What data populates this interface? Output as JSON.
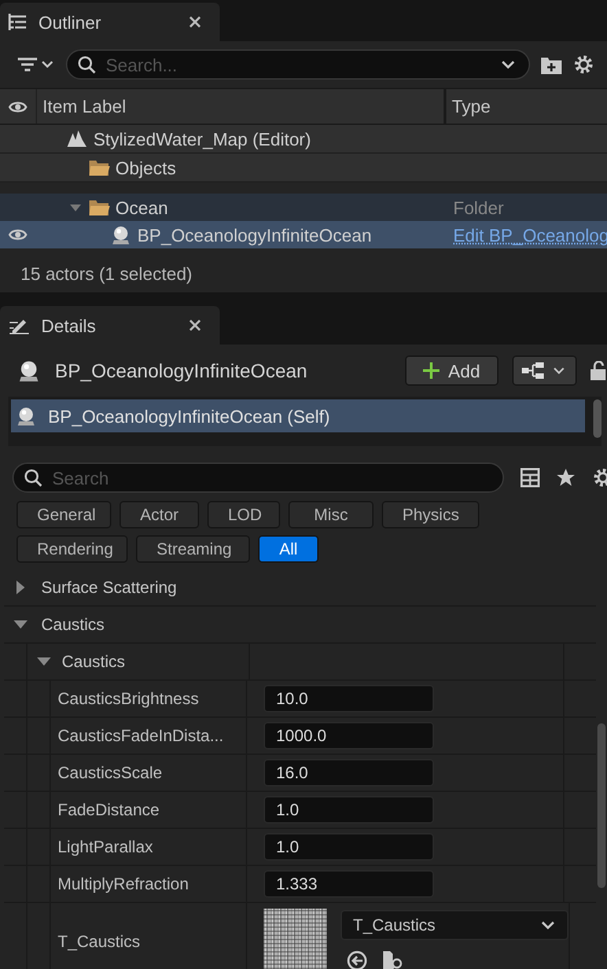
{
  "outliner": {
    "tab": {
      "title": "Outliner"
    },
    "search": {
      "placeholder": "Search..."
    },
    "columns": [
      "Item Label",
      "Type"
    ],
    "tree": [
      {
        "label": "StylizedWater_Map (Editor)",
        "kind": "map",
        "pinned": true,
        "selected": false,
        "highlighted": false,
        "visible": false,
        "children": [
          {
            "label": "Objects",
            "kind": "folder",
            "pinned": true,
            "selected": false,
            "highlighted": false,
            "visible": false
          },
          {
            "label": "Ocean",
            "kind": "folder",
            "type": "Folder",
            "pinned": false,
            "expanded": true,
            "selected": false,
            "highlighted": true,
            "visible": false,
            "children": [
              {
                "label": "BP_OceanologyInfiniteOcean",
                "kind": "actor",
                "type": "Edit BP_Oceanolog",
                "type_link": true,
                "pinned": false,
                "selected": true,
                "highlighted": false,
                "visible": true
              }
            ]
          }
        ]
      }
    ],
    "status": "15 actors (1 selected)"
  },
  "details": {
    "tab": {
      "title": "Details"
    },
    "actor_name": "BP_OceanologyInfiniteOcean",
    "add_button": "Add",
    "components": [
      {
        "label": "BP_OceanologyInfiniteOcean (Self)",
        "selected": true
      }
    ],
    "search": {
      "placeholder": "Search"
    },
    "filters": [
      {
        "label": "General",
        "selected": false
      },
      {
        "label": "Actor",
        "selected": false
      },
      {
        "label": "LOD",
        "selected": false
      },
      {
        "label": "Misc",
        "selected": false
      },
      {
        "label": "Physics",
        "selected": false
      },
      {
        "label": "Rendering",
        "selected": false
      },
      {
        "label": "Streaming",
        "selected": false
      },
      {
        "label": "All",
        "selected": true
      }
    ],
    "categories": [
      {
        "label": "Surface Scattering",
        "expanded": false
      },
      {
        "label": "Caustics",
        "expanded": true,
        "groups": [
          {
            "label": "Caustics",
            "expanded": true,
            "properties": [
              {
                "name": "CausticsBrightness",
                "kind": "number",
                "value": "10.0"
              },
              {
                "name": "CausticsFadeInDista...",
                "kind": "number",
                "value": "1000.0"
              },
              {
                "name": "CausticsScale",
                "kind": "number",
                "value": "16.0"
              },
              {
                "name": "FadeDistance",
                "kind": "number",
                "value": "1.0"
              },
              {
                "name": "LightParallax",
                "kind": "number",
                "value": "1.0"
              },
              {
                "name": "MultiplyRefraction",
                "kind": "number",
                "value": "1.333"
              },
              {
                "name": "T_Caustics",
                "kind": "texture",
                "value": "T_Caustics"
              }
            ]
          }
        ]
      }
    ]
  }
}
